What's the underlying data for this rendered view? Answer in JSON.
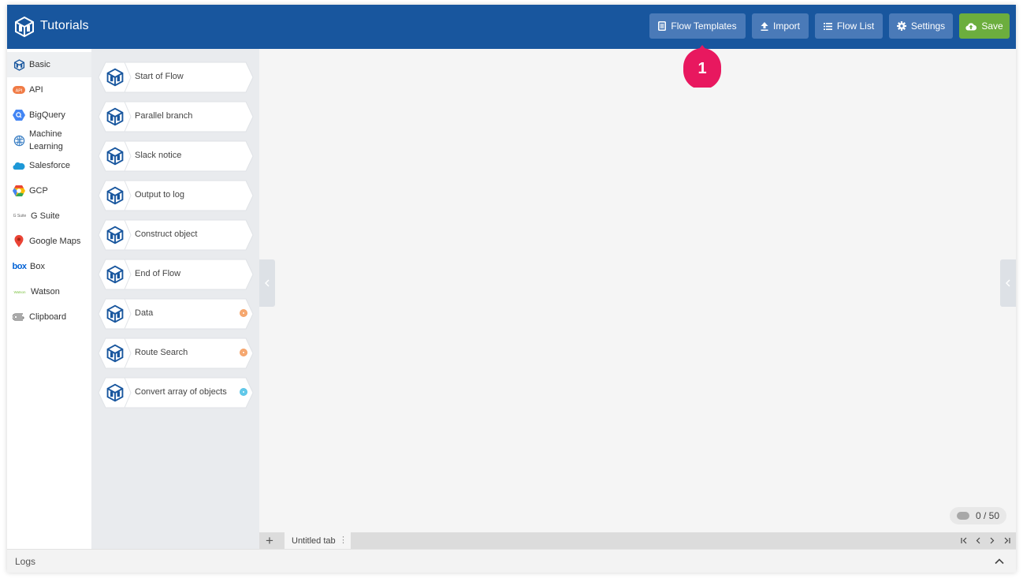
{
  "header": {
    "title": "Tutorials",
    "buttons": {
      "flow_templates": "Flow Templates",
      "import": "Import",
      "flow_list": "Flow List",
      "settings": "Settings",
      "save": "Save"
    },
    "colors": {
      "bar": "#18569e",
      "button": "#4a7ab8",
      "save": "#6cae3e"
    }
  },
  "callout": {
    "number": "1",
    "color": "#e8185f"
  },
  "categories": [
    {
      "label": "Basic",
      "icon": "basic-cube-icon"
    },
    {
      "label": "API",
      "icon": "api-icon"
    },
    {
      "label": "BigQuery",
      "icon": "bigquery-icon"
    },
    {
      "label": "Machine Learning",
      "icon": "brain-icon"
    },
    {
      "label": "Salesforce",
      "icon": "salesforce-cloud-icon"
    },
    {
      "label": "GCP",
      "icon": "gcp-icon"
    },
    {
      "label": "G Suite",
      "icon": "gsuite-icon",
      "icon_text": "G Suite"
    },
    {
      "label": "Google Maps",
      "icon": "map-pin-icon"
    },
    {
      "label": "Box",
      "icon": "box-icon",
      "icon_text": "box"
    },
    {
      "label": "Watson",
      "icon": "watson-icon",
      "icon_text": "Watson"
    },
    {
      "label": "Clipboard",
      "icon": "paperclip-icon"
    }
  ],
  "nodes": [
    {
      "label": "Start of Flow",
      "dot": null
    },
    {
      "label": "Parallel branch",
      "dot": null
    },
    {
      "label": "Slack notice",
      "dot": null
    },
    {
      "label": "Output to log",
      "dot": null
    },
    {
      "label": "Construct object",
      "dot": null
    },
    {
      "label": "End of Flow",
      "dot": null
    },
    {
      "label": "Data",
      "dot": "#f5a46a"
    },
    {
      "label": "Route Search",
      "dot": "#f5a46a"
    },
    {
      "label": "Convert array of objects",
      "dot": "#5bc6e8"
    }
  ],
  "canvas": {
    "node_count": "0 / 50"
  },
  "tabs": {
    "add": "+",
    "items": [
      "Untitled tab"
    ],
    "menu": "⋮"
  },
  "logs": {
    "title": "Logs"
  }
}
